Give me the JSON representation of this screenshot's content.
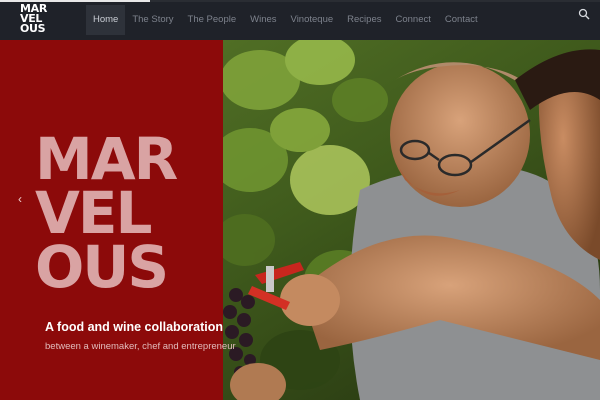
{
  "brand": {
    "logo_lines": [
      "MAR",
      "VEL",
      "OUS"
    ]
  },
  "nav": {
    "items": [
      "Home",
      "The Story",
      "The People",
      "Wines",
      "Vinoteque",
      "Recipes",
      "Connect",
      "Contact"
    ],
    "active": "Home"
  },
  "icons": {
    "search": "search-icon",
    "prev": "chevron-left-icon"
  },
  "hero": {
    "title_lines": [
      "MAR",
      "VEL",
      "OUS"
    ],
    "tagline": "A food and wine collaboration",
    "subtitle": "between a winemaker, chef and entrepreneur",
    "prev_arrow": "‹"
  },
  "colors": {
    "navbar": "#1f2229",
    "panel_red": "#8c0a0a",
    "title_pink": "#d9a3a3"
  }
}
